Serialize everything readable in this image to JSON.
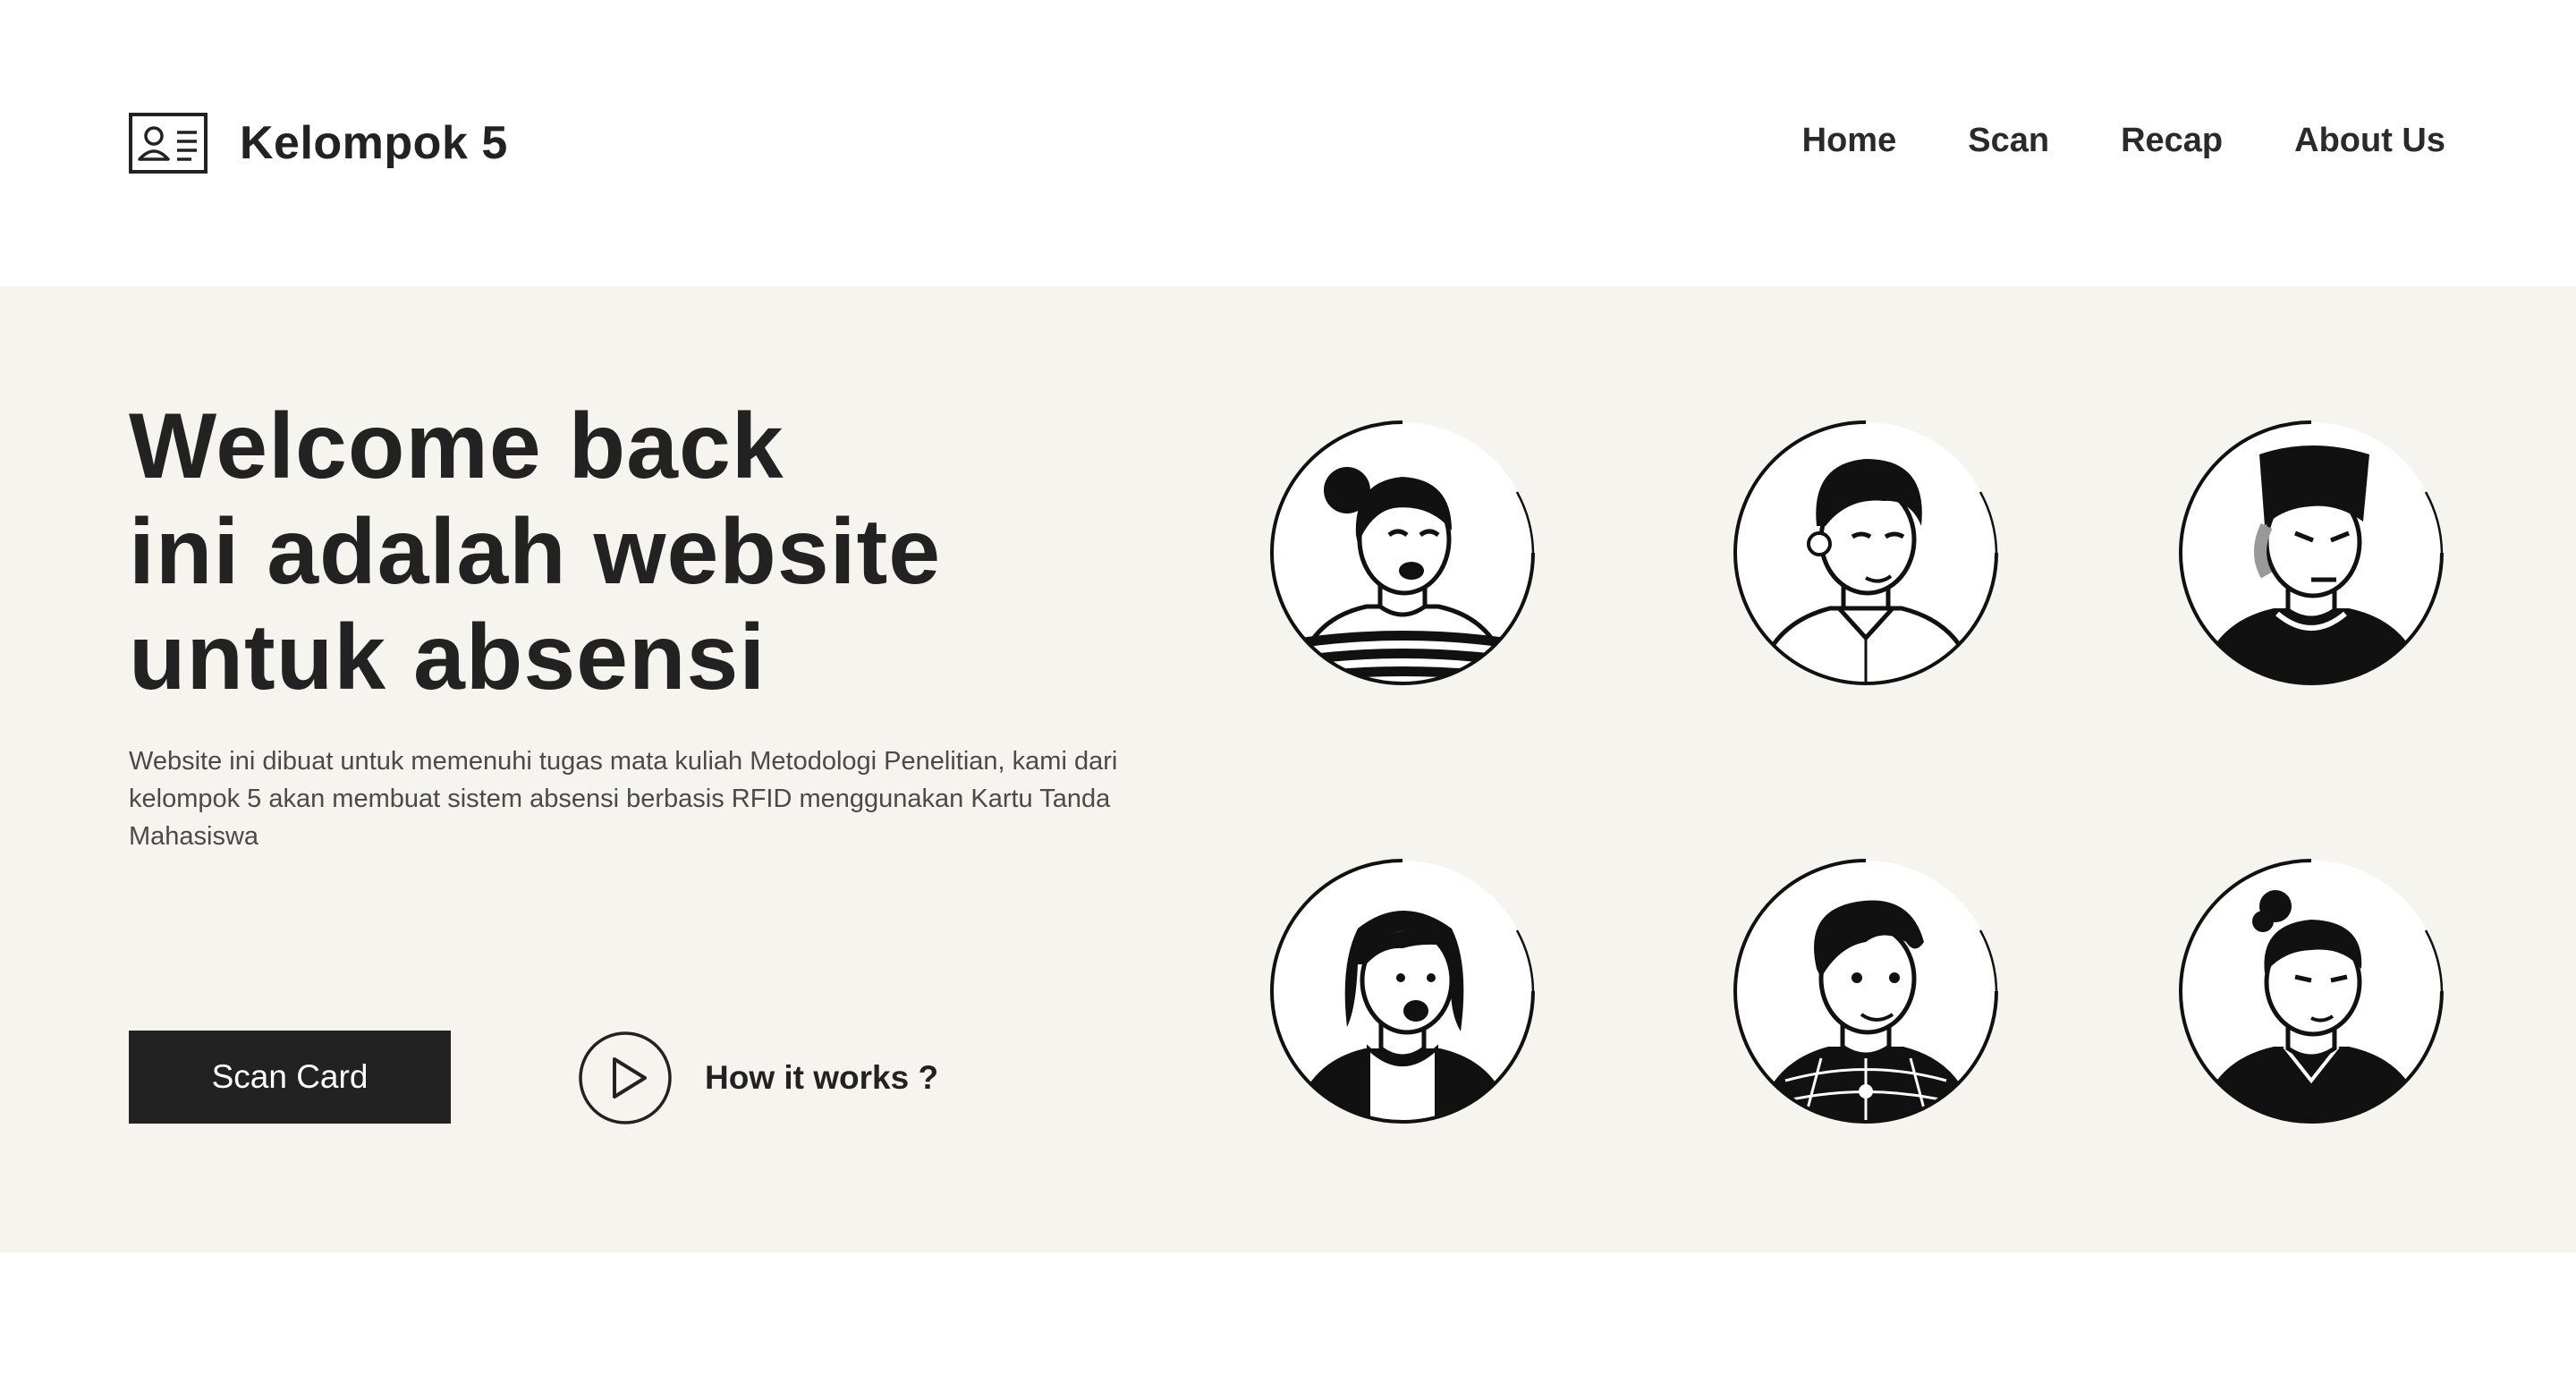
{
  "brand": {
    "name": "Kelompok 5",
    "icon": "id-card-icon"
  },
  "nav": {
    "items": [
      "Home",
      "Scan",
      "Recap",
      "About Us"
    ]
  },
  "hero": {
    "title_lines": [
      "Welcome back",
      "ini adalah website",
      "untuk absensi"
    ],
    "description": "Website ini dibuat untuk memenuhi tugas mata kuliah Metodologi Penelitian, kami dari kelompok 5 akan membuat sistem absensi berbasis RFID menggunakan Kartu Tanda Mahasiswa",
    "primary_button": "Scan Card",
    "secondary_link": "How it works ?",
    "secondary_icon": "play-icon"
  },
  "avatars": [
    {
      "name": "avatar-woman-bun-striped",
      "icon": "avatar-icon"
    },
    {
      "name": "avatar-man-curly-shirt",
      "icon": "avatar-icon"
    },
    {
      "name": "avatar-man-pompadour",
      "icon": "avatar-icon"
    },
    {
      "name": "avatar-woman-bob",
      "icon": "avatar-icon"
    },
    {
      "name": "avatar-man-spider-shirt",
      "icon": "avatar-icon"
    },
    {
      "name": "avatar-man-topknot-jacket",
      "icon": "avatar-icon"
    }
  ],
  "colors": {
    "background": "#ffffff",
    "hero_background": "#f5f4ee",
    "text": "#222222",
    "button": "#222222",
    "button_text": "#ffffff"
  }
}
